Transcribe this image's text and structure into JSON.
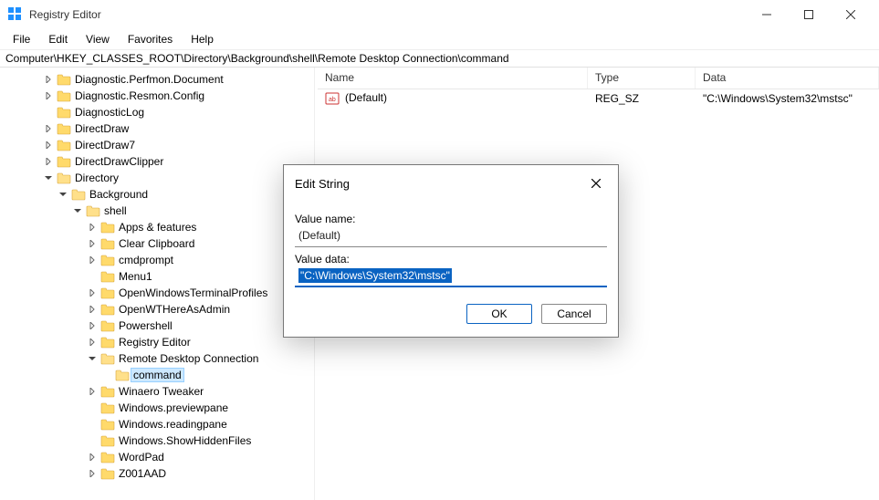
{
  "window": {
    "title": "Registry Editor"
  },
  "menu": {
    "file": "File",
    "edit": "Edit",
    "view": "View",
    "favorites": "Favorites",
    "help": "Help"
  },
  "address": "Computer\\HKEY_CLASSES_ROOT\\Directory\\Background\\shell\\Remote Desktop Connection\\command",
  "tree": {
    "items": [
      {
        "d": 2,
        "tw": ">",
        "label": "Diagnostic.Perfmon.Document"
      },
      {
        "d": 2,
        "tw": ">",
        "label": "Diagnostic.Resmon.Config"
      },
      {
        "d": 2,
        "tw": "",
        "label": "DiagnosticLog"
      },
      {
        "d": 2,
        "tw": ">",
        "label": "DirectDraw"
      },
      {
        "d": 2,
        "tw": ">",
        "label": "DirectDraw7"
      },
      {
        "d": 2,
        "tw": ">",
        "label": "DirectDrawClipper"
      },
      {
        "d": 2,
        "tw": "v",
        "label": "Directory"
      },
      {
        "d": 3,
        "tw": "v",
        "label": "Background"
      },
      {
        "d": 4,
        "tw": "v",
        "label": "shell"
      },
      {
        "d": 5,
        "tw": ">",
        "label": "Apps & features"
      },
      {
        "d": 5,
        "tw": ">",
        "label": "Clear Clipboard"
      },
      {
        "d": 5,
        "tw": ">",
        "label": "cmdprompt"
      },
      {
        "d": 5,
        "tw": "",
        "label": "Menu1"
      },
      {
        "d": 5,
        "tw": ">",
        "label": "OpenWindowsTerminalProfiles"
      },
      {
        "d": 5,
        "tw": ">",
        "label": "OpenWTHereAsAdmin"
      },
      {
        "d": 5,
        "tw": ">",
        "label": "Powershell"
      },
      {
        "d": 5,
        "tw": ">",
        "label": "Registry Editor"
      },
      {
        "d": 5,
        "tw": "v",
        "label": "Remote Desktop Connection"
      },
      {
        "d": 6,
        "tw": "",
        "label": "command",
        "selected": true
      },
      {
        "d": 5,
        "tw": ">",
        "label": "Winaero Tweaker"
      },
      {
        "d": 5,
        "tw": "",
        "label": "Windows.previewpane"
      },
      {
        "d": 5,
        "tw": "",
        "label": "Windows.readingpane"
      },
      {
        "d": 5,
        "tw": "",
        "label": "Windows.ShowHiddenFiles"
      },
      {
        "d": 5,
        "tw": ">",
        "label": "WordPad"
      },
      {
        "d": 5,
        "tw": ">",
        "label": "Z001AAD"
      }
    ]
  },
  "list": {
    "headers": {
      "name": "Name",
      "type": "Type",
      "data": "Data"
    },
    "rows": [
      {
        "name": "(Default)",
        "type": "REG_SZ",
        "data": "\"C:\\Windows\\System32\\mstsc\""
      }
    ]
  },
  "dialog": {
    "title": "Edit String",
    "value_name_label": "Value name:",
    "value_name": "(Default)",
    "value_data_label": "Value data:",
    "value_data": "\"C:\\Windows\\System32\\mstsc\"",
    "ok": "OK",
    "cancel": "Cancel"
  }
}
